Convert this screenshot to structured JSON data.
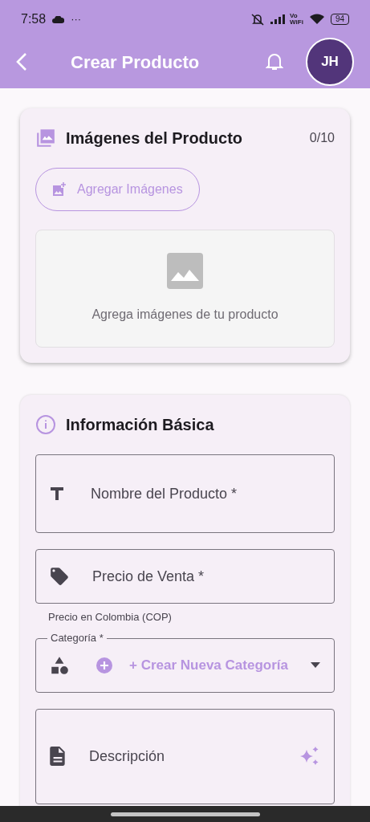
{
  "status_bar": {
    "time": "7:58",
    "more": "···",
    "vowifi": [
      "Vo",
      "WiFi"
    ],
    "battery": "94"
  },
  "app_bar": {
    "title": "Crear Producto",
    "avatar": "JH"
  },
  "images_card": {
    "title": "Imágenes del Producto",
    "count": "0/10",
    "add_button": "Agregar Imágenes",
    "empty_text": "Agrega imágenes de tu producto"
  },
  "basic_card": {
    "title": "Información Básica",
    "fields": [
      {
        "kind": "name",
        "placeholder": "Nombre del Producto *"
      },
      {
        "kind": "price",
        "placeholder": "Precio de Venta *",
        "helper": "Precio en Colombia (COP)"
      },
      {
        "kind": "category",
        "label": "Categoría *",
        "value": "+ Crear Nueva Categoría"
      },
      {
        "kind": "description",
        "placeholder": "Descripción"
      }
    ]
  }
}
